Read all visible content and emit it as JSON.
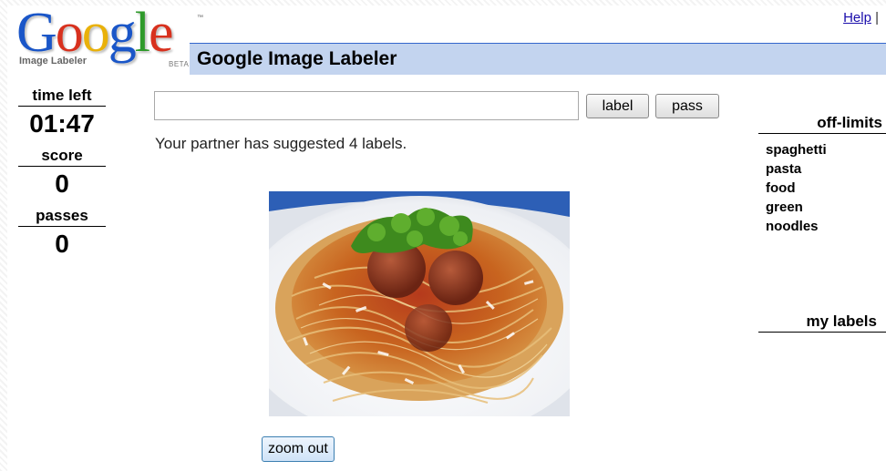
{
  "logo": {
    "letters": [
      "G",
      "o",
      "o",
      "g",
      "l",
      "e"
    ],
    "trademark": "™",
    "subtitle": "Image Labeler",
    "beta": "BETA"
  },
  "header": {
    "help_link": "Help",
    "help_separator": "|",
    "title": "Google Image Labeler"
  },
  "stats": {
    "time_left_label": "time left",
    "time_left_value": "01:47",
    "score_label": "score",
    "score_value": "0",
    "passes_label": "passes",
    "passes_value": "0"
  },
  "controls": {
    "label_input_value": "",
    "label_button": "label",
    "pass_button": "pass",
    "zoom_button": "zoom out"
  },
  "partner_message": "Your partner has suggested 4 labels.",
  "off_limits": {
    "heading": "off-limits",
    "items": [
      "spaghetti",
      "pasta",
      "food",
      "green",
      "noodles"
    ]
  },
  "my_labels": {
    "heading": "my labels",
    "items": []
  },
  "colors": {
    "title_bar": "#c3d4ef",
    "title_bar_border": "#3366cc",
    "link": "#1a0dab"
  },
  "image": {
    "subject": "spaghetti with meatballs, tomato sauce, grated cheese and parsley on a white plate"
  }
}
